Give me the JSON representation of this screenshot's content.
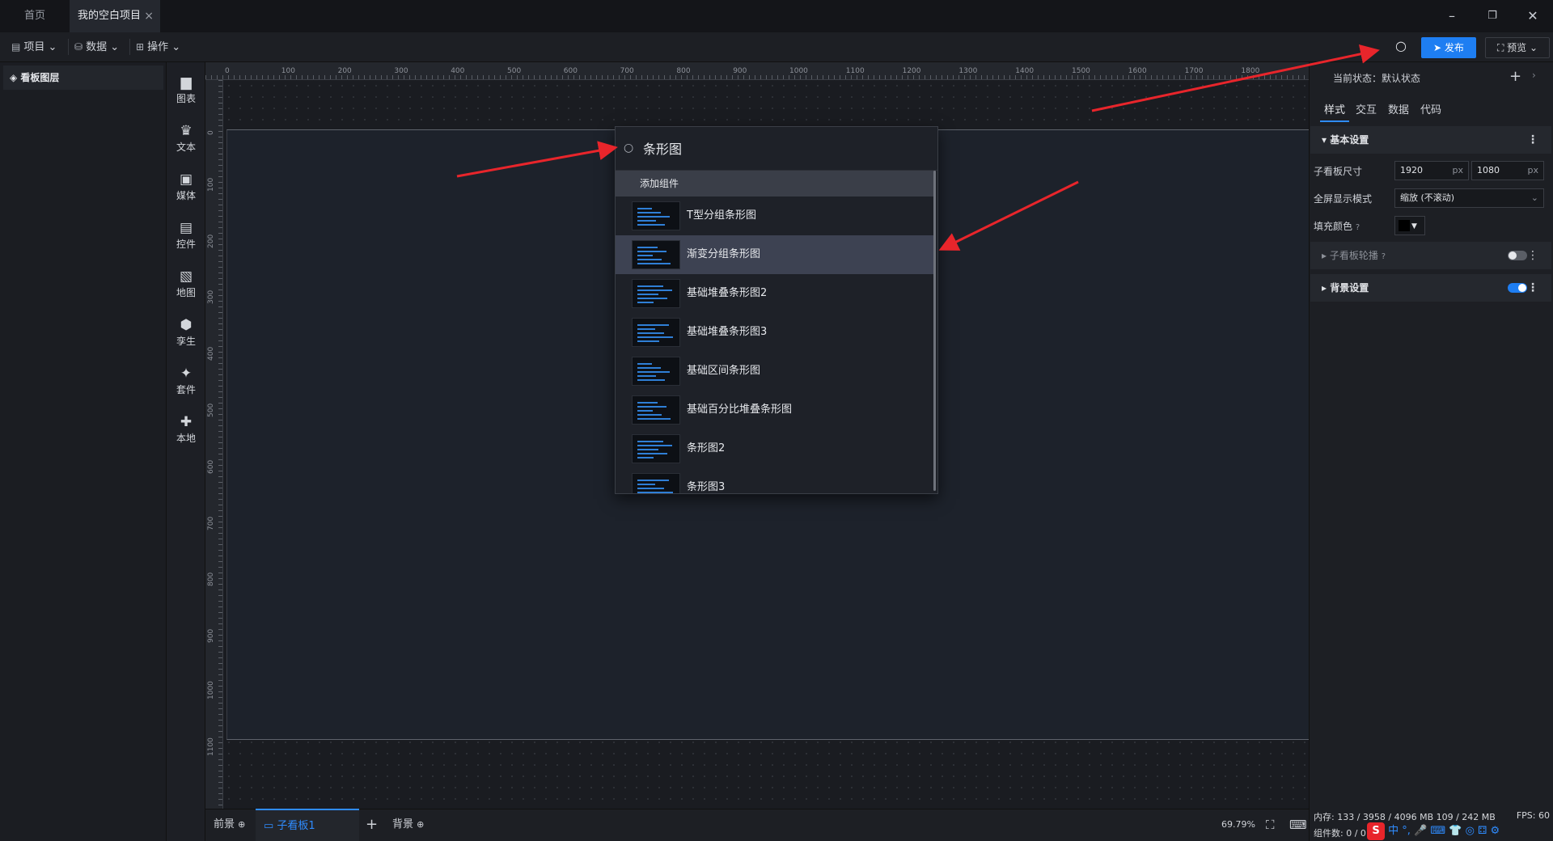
{
  "tabs": {
    "home": "首页",
    "project": "我的空白项目"
  },
  "toolbar": {
    "project": "项目",
    "data": "数据",
    "operate": "操作",
    "publish": "发布",
    "preview": "预览"
  },
  "layers": {
    "title": "看板图层"
  },
  "sidebar": [
    {
      "label": "图表",
      "icon": "bar-chart-icon"
    },
    {
      "label": "文本",
      "icon": "text-icon"
    },
    {
      "label": "媒体",
      "icon": "media-icon"
    },
    {
      "label": "控件",
      "icon": "control-icon"
    },
    {
      "label": "地图",
      "icon": "map-icon"
    },
    {
      "label": "孪生",
      "icon": "twin-icon"
    },
    {
      "label": "套件",
      "icon": "kit-icon"
    },
    {
      "label": "本地",
      "icon": "local-icon"
    }
  ],
  "ruler": {
    "top": [
      "0",
      "100",
      "200",
      "300",
      "400",
      "500",
      "600",
      "700",
      "800",
      "900",
      "1000",
      "1100",
      "1200",
      "1300",
      "1400",
      "1500",
      "1600",
      "1700",
      "1800"
    ],
    "left": [
      "0",
      "100",
      "200",
      "300",
      "400",
      "500",
      "600",
      "700",
      "800",
      "900",
      "1000",
      "1100"
    ]
  },
  "bottom": {
    "foreground": "前景",
    "subboard": "子看板1",
    "add": "+",
    "background": "背景",
    "zoom": "69.79%"
  },
  "dropdown": {
    "query": "条形图",
    "group": "添加组件",
    "items": [
      {
        "label": "T型分组条形图",
        "highlighted": false
      },
      {
        "label": "渐变分组条形图",
        "highlighted": true
      },
      {
        "label": "基础堆叠条形图2",
        "highlighted": false
      },
      {
        "label": "基础堆叠条形图3",
        "highlighted": false
      },
      {
        "label": "基础区间条形图",
        "highlighted": false
      },
      {
        "label": "基础百分比堆叠条形图",
        "highlighted": false
      },
      {
        "label": "条形图2",
        "highlighted": false
      },
      {
        "label": "条形图3",
        "highlighted": false
      }
    ]
  },
  "right": {
    "state_label": "当前状态：默认状态",
    "tabs": [
      "样式",
      "交互",
      "数据",
      "代码"
    ],
    "basic": "基本设置",
    "size_label": "子看板尺寸",
    "width": "1920",
    "height": "1080",
    "unit": "px",
    "fullscreen_label": "全屏显示模式",
    "fullscreen_value": "缩放 (不滚动)",
    "fill_label": "填充颜色",
    "fill_color": "#000000",
    "outline": "子看板轮播",
    "bg": "背景设置"
  },
  "status": {
    "memory": "内存: 133 / 3958 / 4096 MB  109 / 242 MB",
    "fps": "FPS: 60",
    "count": "组件数: 0 / 0"
  },
  "ime": "中 °, 🎤 ⌨ 👕 ◎ ⚃ ⚙",
  "colors": {
    "accent": "#1e7ef2",
    "arrow": "#e8252b",
    "highlight": "#3d4252"
  }
}
